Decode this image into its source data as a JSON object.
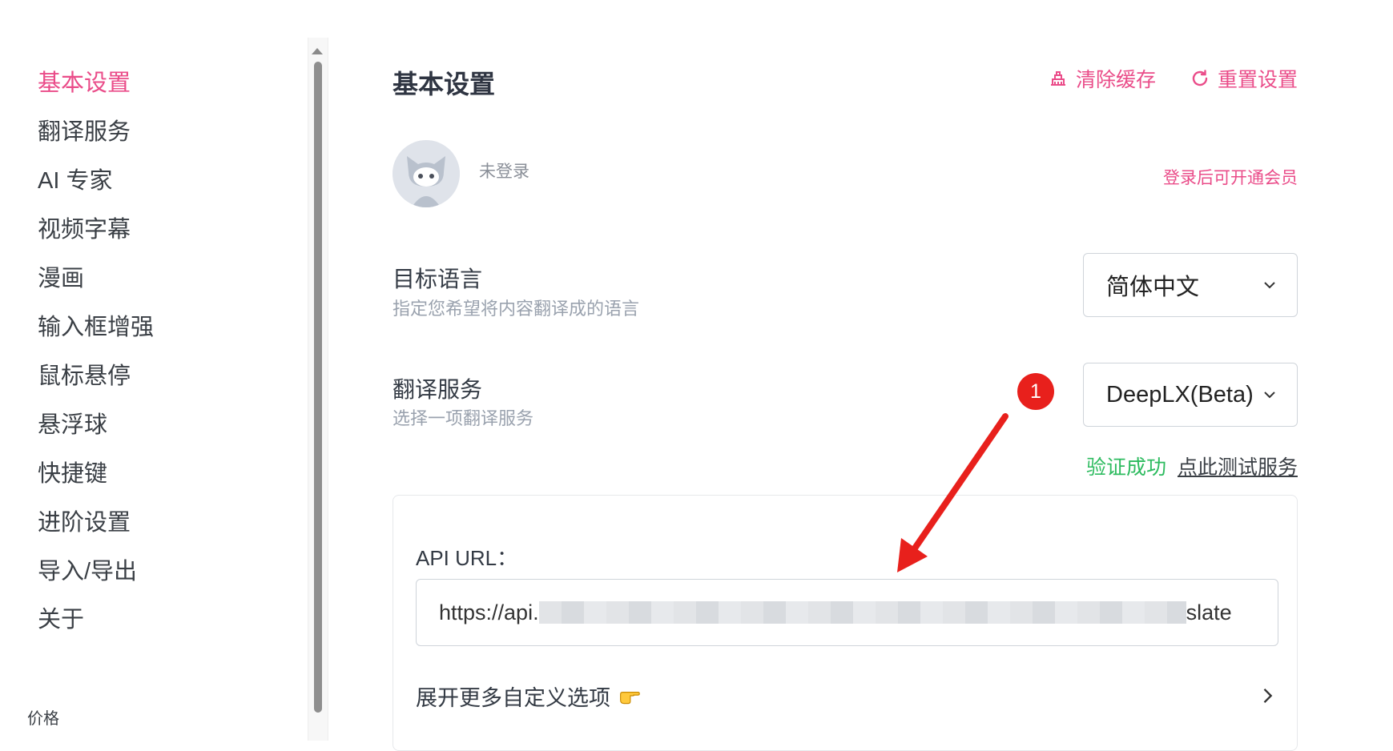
{
  "sidebar": {
    "items": [
      {
        "label": "基本设置"
      },
      {
        "label": "翻译服务"
      },
      {
        "label": "AI 专家"
      },
      {
        "label": "视频字幕"
      },
      {
        "label": "漫画"
      },
      {
        "label": "输入框增强"
      },
      {
        "label": "鼠标悬停"
      },
      {
        "label": "悬浮球"
      },
      {
        "label": "快捷键"
      },
      {
        "label": "进阶设置"
      },
      {
        "label": "导入/导出"
      },
      {
        "label": "关于"
      }
    ],
    "pricing_label": "价格"
  },
  "header": {
    "title": "基本设置",
    "clear_cache_label": "清除缓存",
    "reset_label": "重置设置"
  },
  "account": {
    "status": "未登录",
    "member_link": "登录后可开通会员"
  },
  "target_language": {
    "label": "目标语言",
    "description": "指定您希望将内容翻译成的语言",
    "value": "简体中文"
  },
  "translation_service": {
    "label": "翻译服务",
    "description": "选择一项翻译服务",
    "value": "DeepLX(Beta)",
    "verify_status": "验证成功",
    "test_link": "点此测试服务"
  },
  "annotation": {
    "badge_number": "1"
  },
  "api": {
    "label": "API URL：",
    "value_prefix": "https://api.",
    "value_suffix": "slate"
  },
  "expand": {
    "label": "展开更多自定义选项"
  },
  "colors": {
    "accent": "#ea4c89",
    "success": "#2dbb5f",
    "annotation_red": "#e8201c"
  }
}
